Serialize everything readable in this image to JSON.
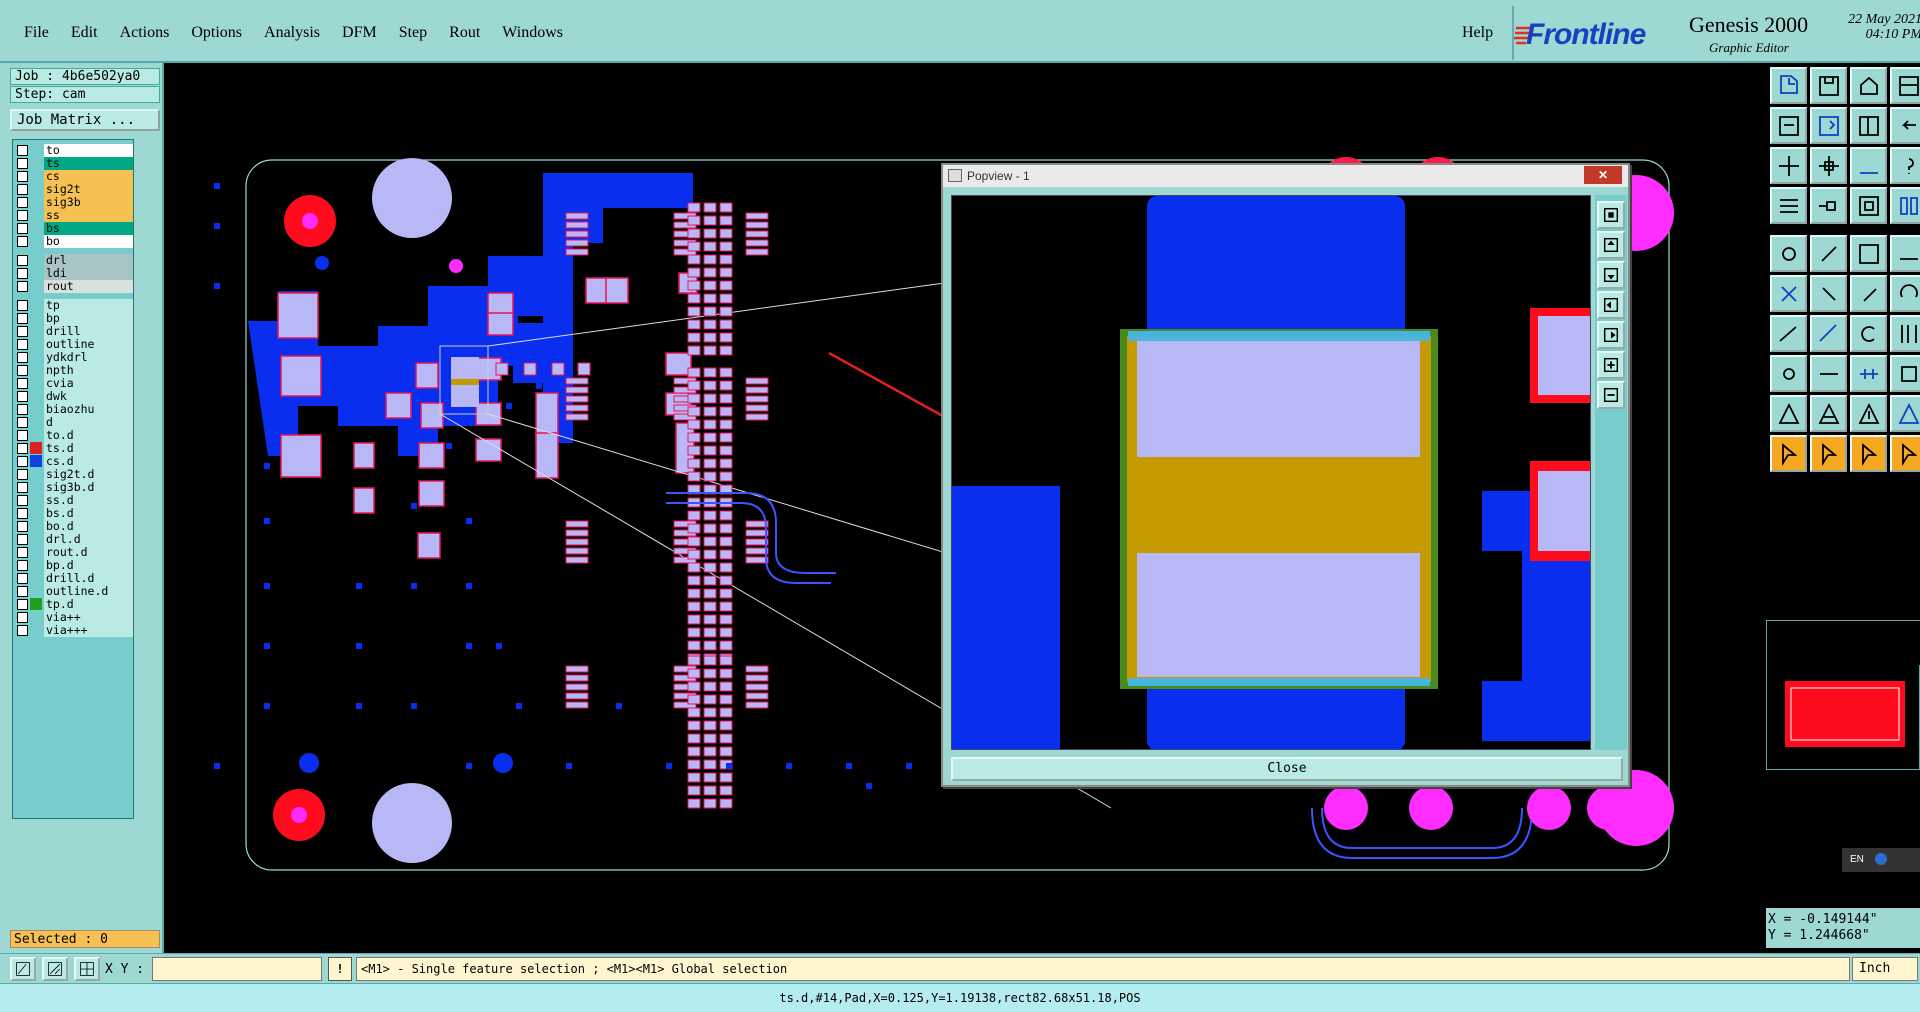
{
  "menu": {
    "items": [
      "File",
      "Edit",
      "Actions",
      "Options",
      "Analysis",
      "DFM",
      "Step",
      "Rout",
      "Windows"
    ],
    "help": "Help"
  },
  "brand": {
    "logo": "Frontline",
    "product": "Genesis 2000",
    "edition": "Graphic Editor",
    "date": "22 May 2021",
    "time": "04:10 PM",
    "logo_color": "#1a3fc0",
    "logo_mark_color": "#e03020"
  },
  "job": {
    "job_label": "Job : 4b6e502ya0",
    "step_label": "Step: cam",
    "matrix_button": "Job Matrix ..."
  },
  "layers": [
    {
      "name": "to",
      "color": "#ffffff",
      "mark": "✎"
    },
    {
      "name": "ts",
      "color": "#00a884",
      "mark": ""
    },
    {
      "name": "cs",
      "color": "#f6c053",
      "mark": ""
    },
    {
      "name": "sig2t",
      "color": "#f6c053",
      "mark": ""
    },
    {
      "name": "sig3b",
      "color": "#f6c053",
      "mark": ""
    },
    {
      "name": "ss",
      "color": "#f6c053",
      "mark": ""
    },
    {
      "name": "bs",
      "color": "#00a884",
      "mark": ""
    },
    {
      "name": "bo",
      "color": "#ffffff",
      "mark": "✎"
    },
    {
      "name": "drl",
      "color": "#a8c4c4",
      "mark": ""
    },
    {
      "name": "ldi",
      "color": "#a8c4c4",
      "mark": ""
    },
    {
      "name": "rout",
      "color": "#d9e0e0",
      "mark": ""
    },
    {
      "name": "tp",
      "color": "#b9eae4",
      "mark": ""
    },
    {
      "name": "bp",
      "color": "#b9eae4",
      "mark": ""
    },
    {
      "name": "drill",
      "color": "#b9eae4",
      "mark": ""
    },
    {
      "name": "outline",
      "color": "#b9eae4",
      "mark": ""
    },
    {
      "name": "ydkdrl",
      "color": "#b9eae4",
      "mark": ""
    },
    {
      "name": "npth",
      "color": "#b9eae4",
      "mark": ""
    },
    {
      "name": "cvia",
      "color": "#b9eae4",
      "mark": ""
    },
    {
      "name": "dwk",
      "color": "#b9eae4",
      "mark": ""
    },
    {
      "name": "biaozhu",
      "color": "#b9eae4",
      "mark": ""
    },
    {
      "name": "d",
      "color": "#b9eae4",
      "mark": ""
    },
    {
      "name": "to.d",
      "color": "#b9eae4",
      "mark": "✎"
    },
    {
      "name": "ts.d",
      "color": "#b9eae4",
      "mark": "▫",
      "swatch": "#e02020"
    },
    {
      "name": "cs.d",
      "color": "#b9eae4",
      "mark": "",
      "swatch": "#1040e0"
    },
    {
      "name": "sig2t.d",
      "color": "#b9eae4",
      "mark": ""
    },
    {
      "name": "sig3b.d",
      "color": "#b9eae4",
      "mark": ""
    },
    {
      "name": "ss.d",
      "color": "#b9eae4",
      "mark": ""
    },
    {
      "name": "bs.d",
      "color": "#b9eae4",
      "mark": ""
    },
    {
      "name": "bo.d",
      "color": "#b9eae4",
      "mark": "✎"
    },
    {
      "name": "drl.d",
      "color": "#b9eae4",
      "mark": ""
    },
    {
      "name": "rout.d",
      "color": "#b9eae4",
      "mark": ""
    },
    {
      "name": "bp.d",
      "color": "#b9eae4",
      "mark": ""
    },
    {
      "name": "drill.d",
      "color": "#b9eae4",
      "mark": ""
    },
    {
      "name": "outline.d",
      "color": "#b9eae4",
      "mark": ""
    },
    {
      "name": "tp.d",
      "color": "#b9eae4",
      "mark": "",
      "swatch": "#20a020"
    },
    {
      "name": "via++",
      "color": "#b9eae4",
      "mark": ""
    },
    {
      "name": "via+++",
      "color": "#b9eae4",
      "mark": ""
    }
  ],
  "selected": "Selected : 0",
  "popview": {
    "title": "Popview - 1",
    "close_x": "✕",
    "close_button": "Close"
  },
  "coords": {
    "x": "X = -0.149144\"",
    "y": "Y =  1.244668\""
  },
  "bottom": {
    "xy_label": "X Y :",
    "xy_value": "",
    "warn": "!",
    "prompt": "<M1> - Single feature selection ; <M1><M1> Global selection",
    "units": "Inch"
  },
  "status": "ts.d,#14,Pad,X=0.125,Y=1.19138,rect82.68x51.18,POS",
  "lang": "EN",
  "colors": {
    "panel": "#9ed8d2",
    "copper": "#0a2ef0",
    "pad": "#b8b8f6",
    "mask": "#e8145a",
    "magenta": "#ff2cff",
    "gold": "#c49a00",
    "highlight": "#f6a823"
  }
}
